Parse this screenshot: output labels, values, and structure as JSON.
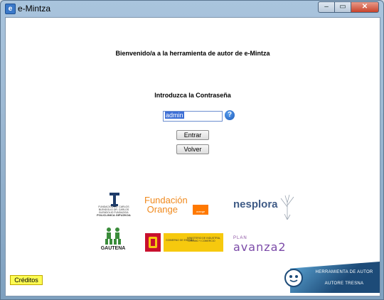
{
  "window": {
    "title": "e-Mintza",
    "minimize": "–",
    "maximize": "▭",
    "close": "✕"
  },
  "main": {
    "welcome": "Bienvenido/a a la herramienta de autor de e-Mintza",
    "password_prompt": "Introduzca la Contraseña",
    "password_value": "admin",
    "help_icon": "?",
    "enter_button": "Entrar",
    "back_button": "Volver"
  },
  "logos": {
    "carlos_slim": {
      "text_left": "FUNDACIÓN DR. CARLOS BLENDOLIO",
      "text_right": "DR. CARLOS BLENDOLIO FUNDAZIOA",
      "bottom": "POLICLINICA GIPUZKOA"
    },
    "fundacion_orange": {
      "line1": "Fundación",
      "line2": "Orange",
      "badge": "orange"
    },
    "nesplora": "nesplora",
    "gautena": "GAUTENA",
    "gobierno": {
      "left": "GOBIERNO DE ESPAÑA",
      "right": "MINISTERIO DE INDUSTRIA, TURISMO Y COMERCIO"
    },
    "plan_avanza": {
      "small": "PLAN",
      "big": "avanza2"
    }
  },
  "footer": {
    "credits_button": "Créditos",
    "tresna_line1": "HERRAMIENTA DE AUTOR",
    "tresna_line2": "AUTORE TRESNA"
  }
}
